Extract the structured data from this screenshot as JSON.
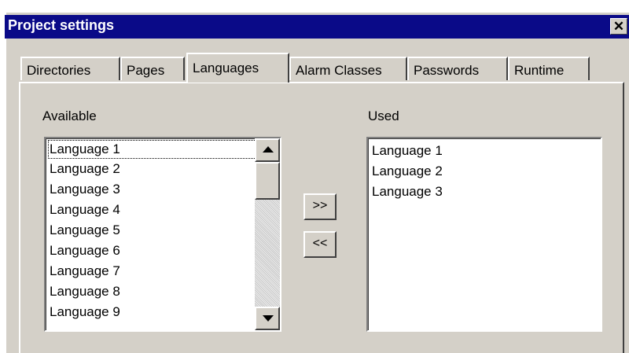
{
  "window": {
    "title": "Project settings",
    "close_glyph": "✕"
  },
  "tabs": [
    {
      "label": "Directories",
      "active": false
    },
    {
      "label": "Pages",
      "active": false
    },
    {
      "label": "Languages",
      "active": true
    },
    {
      "label": "Alarm Classes",
      "active": false
    },
    {
      "label": "Passwords",
      "active": false
    },
    {
      "label": "Runtime",
      "active": false
    }
  ],
  "available": {
    "label": "Available",
    "items": [
      "Language 1",
      "Language 2",
      "Language 3",
      "Language 4",
      "Language 5",
      "Language 6",
      "Language 7",
      "Language 8",
      "Language 9"
    ],
    "focused_index": 0
  },
  "used": {
    "label": "Used",
    "items": [
      "Language 1",
      "Language 2",
      "Language 3"
    ]
  },
  "buttons": {
    "add": ">>",
    "remove": "<<"
  },
  "colors": {
    "titlebar": "#0a0a88",
    "face": "#d4d0c8",
    "list_bg": "#ffffff"
  }
}
